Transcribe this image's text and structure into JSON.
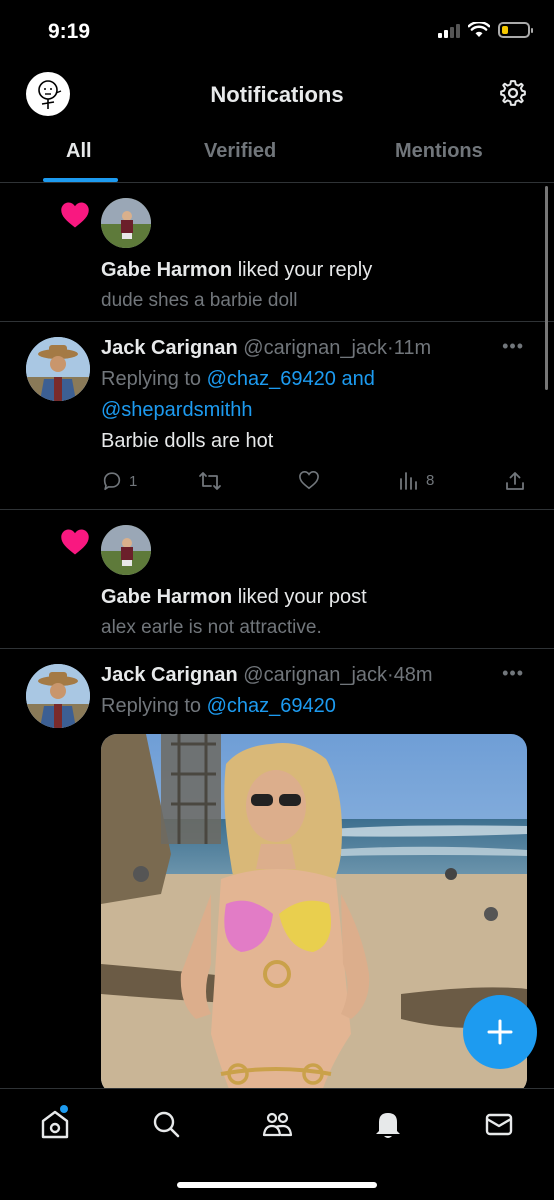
{
  "status_bar": {
    "time": "9:19",
    "battery_level": 0.2
  },
  "header": {
    "title": "Notifications"
  },
  "tabs": [
    {
      "label": "All",
      "active": true
    },
    {
      "label": "Verified",
      "active": false
    },
    {
      "label": "Mentions",
      "active": false
    }
  ],
  "notifications": {
    "like1": {
      "user": "Gabe Harmon",
      "action": " liked your reply",
      "snippet": "dude shes a barbie doll"
    },
    "tweet1": {
      "name": "Jack Carignan",
      "handle": "@carignan_jack",
      "time": "11m",
      "replying_label": "Replying to ",
      "mention1": "@chaz_69420",
      "conj": " and",
      "mention2": "@shepardsmithh",
      "body": "Barbie dolls are hot",
      "replies": "1",
      "views": "8"
    },
    "like2": {
      "user": "Gabe Harmon",
      "action": " liked your post",
      "snippet": "alex earle is not attractive."
    },
    "tweet2": {
      "name": "Jack Carignan",
      "handle": "@carignan_jack",
      "time": "48m",
      "replying_label": "Replying to ",
      "mention1": "@chaz_69420"
    }
  },
  "nav": [
    "home-icon",
    "search-icon",
    "communities-icon",
    "notifications-icon",
    "messages-icon"
  ],
  "colors": {
    "accent": "#1d9bf0",
    "like": "#f91880",
    "background": "#000000",
    "secondary_text": "#71767b"
  }
}
